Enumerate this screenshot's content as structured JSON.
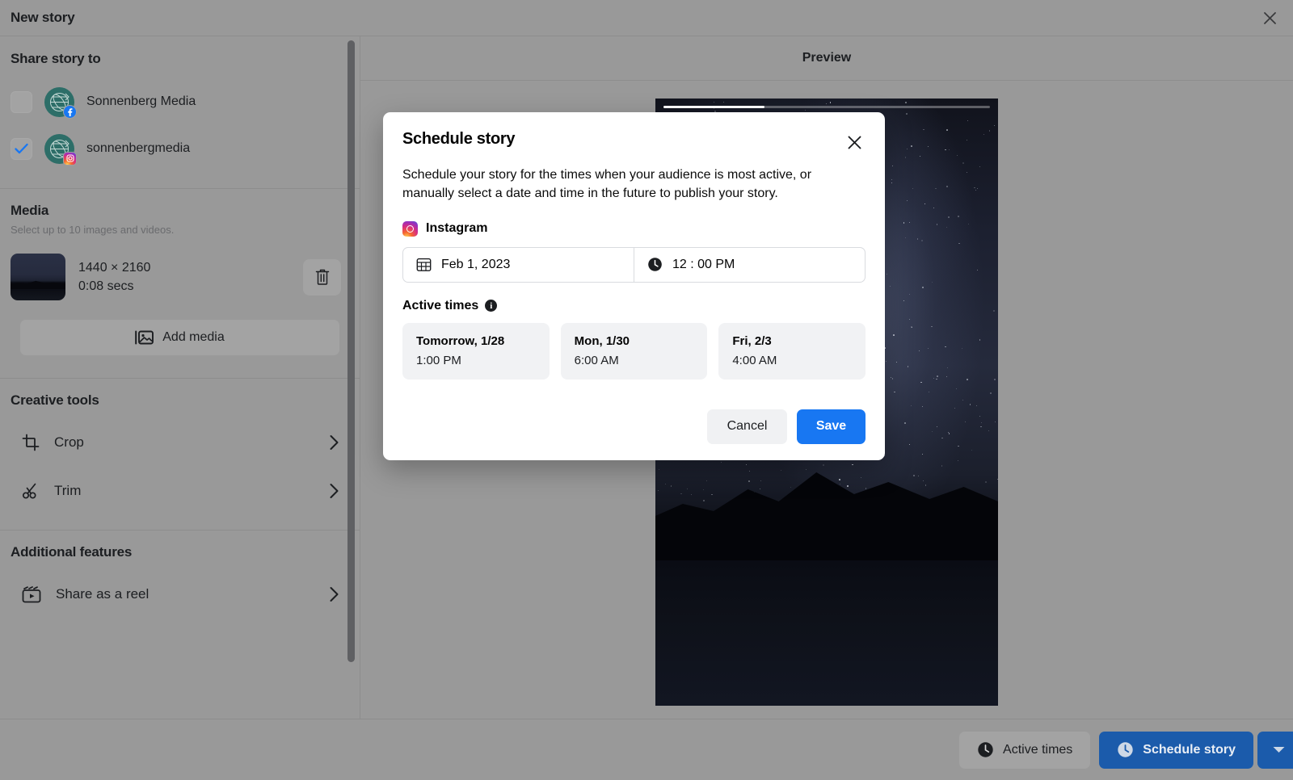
{
  "window": {
    "title": "New story",
    "close_icon": "close-icon"
  },
  "sidebar": {
    "share": {
      "title": "Share story to",
      "accounts": [
        {
          "name": "Sonnenberg Media",
          "platform": "facebook",
          "checked": false
        },
        {
          "name": "sonnenbergmedia",
          "platform": "instagram",
          "checked": true
        }
      ]
    },
    "media": {
      "title": "Media",
      "subtitle": "Select up to 10 images and videos.",
      "item": {
        "dimensions": "1440 × 2160",
        "duration": "0:08 secs"
      },
      "delete_icon": "trash-icon",
      "add_media_label": "Add media",
      "add_media_icon": "image-icon"
    },
    "creative_tools": {
      "title": "Creative tools",
      "items": [
        {
          "label": "Crop",
          "icon": "crop-icon"
        },
        {
          "label": "Trim",
          "icon": "scissors-icon"
        }
      ]
    },
    "additional_features": {
      "title": "Additional features",
      "items": [
        {
          "label": "Share as a reel",
          "icon": "reel-icon"
        }
      ]
    }
  },
  "preview": {
    "title": "Preview",
    "progress_percent": 31
  },
  "bottom_bar": {
    "active_times_label": "Active times",
    "active_times_icon": "clock-icon",
    "schedule_label": "Schedule story",
    "schedule_icon": "clock-icon",
    "schedule_dropdown_icon": "chevron-down-icon",
    "schedule_color": "#1b5bab"
  },
  "modal": {
    "title": "Schedule story",
    "close_icon": "close-icon",
    "description": "Schedule your story for the times when your audience is most active, or manually select a date and time in the future to publish your story.",
    "platform": {
      "name": "Instagram",
      "icon": "instagram-icon"
    },
    "date_field": {
      "icon": "calendar-icon",
      "value": "Feb 1, 2023"
    },
    "time_field": {
      "icon": "clock-icon",
      "value": "12 : 00 PM"
    },
    "active_times": {
      "label": "Active times",
      "info_icon": "info-icon",
      "info_glyph": "i",
      "suggestions": [
        {
          "day": "Tomorrow, 1/28",
          "time": "1:00 PM"
        },
        {
          "day": "Mon, 1/30",
          "time": "6:00 AM"
        },
        {
          "day": "Fri, 2/3",
          "time": "4:00 AM"
        }
      ]
    },
    "cancel_label": "Cancel",
    "save_label": "Save",
    "save_color": "#1877f2"
  }
}
